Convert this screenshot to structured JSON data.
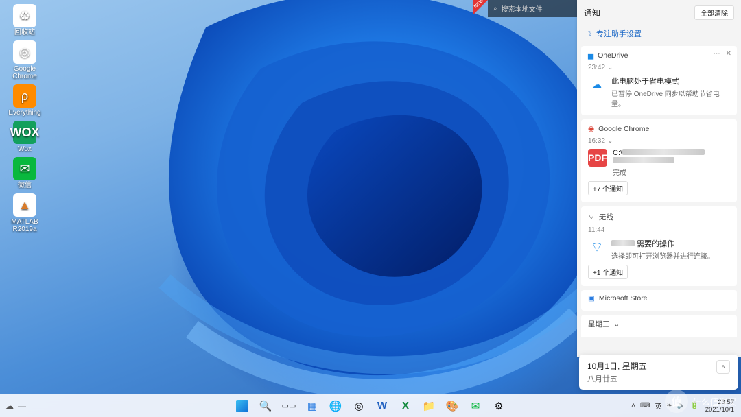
{
  "desktop_icons": [
    {
      "name": "recycle-bin",
      "label": "回收站",
      "glyph": "♻"
    },
    {
      "name": "google-chrome",
      "label": "Google Chrome",
      "glyph": "◎"
    },
    {
      "name": "everything",
      "label": "Everything",
      "glyph": "ρ"
    },
    {
      "name": "wox",
      "label": "Wox",
      "glyph": "WOX"
    },
    {
      "name": "wechat",
      "label": "微信",
      "glyph": "✉"
    },
    {
      "name": "matlab",
      "label": "MATLAB R2019a",
      "glyph": "▲"
    }
  ],
  "searchbar": {
    "placeholder": "搜索本地文件",
    "new_tag": "NEW"
  },
  "panel": {
    "title": "通知",
    "clear_all": "全部清除",
    "focus_assist": "专注助手设置",
    "groups": [
      {
        "app": "OneDrive",
        "has_close": true,
        "time": "23:42",
        "title": "此电脑处于省电模式",
        "subtitle": "已暂停 OneDrive 同步以帮助节省电量。",
        "icon": "cloud"
      },
      {
        "app": "Google Chrome",
        "time": "16:32",
        "title": "C:\\",
        "title_obscured": true,
        "subtitle": "完成",
        "icon": "pdf",
        "more": "+7 个通知"
      },
      {
        "app": "无线",
        "time": "11:44",
        "title": "需要的操作",
        "title_prefix_obscured": true,
        "subtitle": "选择即可打开浏览器并进行连接。",
        "icon": "wifi",
        "more": "+1 个通知"
      },
      {
        "app": "Microsoft Store",
        "mini": true
      },
      {
        "app": "星期三",
        "mini": true,
        "chevron": true,
        "cut": true
      }
    ]
  },
  "date_card": {
    "line1": "10月1日, 星期五",
    "line2": "八月廿五"
  },
  "taskbar": {
    "left": [
      "☁",
      "—"
    ],
    "center": [
      {
        "name": "start",
        "glyph": "win"
      },
      {
        "name": "search",
        "glyph": "🔍"
      },
      {
        "name": "task-view",
        "glyph": "▭▭"
      },
      {
        "name": "widgets",
        "glyph": "▦"
      },
      {
        "name": "edge",
        "glyph": "🌐"
      },
      {
        "name": "chrome",
        "glyph": "◎"
      },
      {
        "name": "word",
        "glyph": "W"
      },
      {
        "name": "excel",
        "glyph": "X"
      },
      {
        "name": "explorer",
        "glyph": "📁"
      },
      {
        "name": "paint",
        "glyph": "🎨"
      },
      {
        "name": "mail",
        "glyph": "✉"
      },
      {
        "name": "settings",
        "glyph": "⚙"
      }
    ],
    "tray": {
      "chevron": "˄",
      "ime1": "⌨",
      "ime2": "英",
      "ime3": "❧",
      "vol": "🔈",
      "net": "🔋"
    },
    "clock": {
      "time": "23:57",
      "date": "2021/10/1"
    }
  },
  "watermark": {
    "circle": "值",
    "text": "什么值得买"
  }
}
